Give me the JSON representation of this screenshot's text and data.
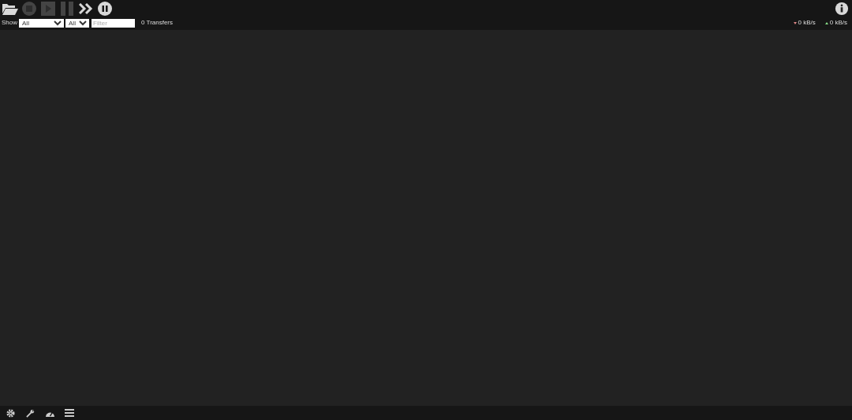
{
  "toolbar": {
    "buttons": [
      {
        "kind": "open",
        "disabled": false
      },
      {
        "kind": "stop",
        "disabled": true
      },
      {
        "kind": "play",
        "disabled": true
      },
      {
        "kind": "pause",
        "disabled": true
      },
      {
        "kind": "start-all",
        "disabled": false
      },
      {
        "kind": "pause-all",
        "disabled": false
      }
    ]
  },
  "filterbar": {
    "show_label": "Show",
    "state_filter": "All",
    "tracker_filter": "All",
    "search": {
      "placeholder": "Filter"
    },
    "count": "0 Transfers",
    "download_speed": "0 kB/s",
    "upload_speed": "0 kB/s"
  },
  "footer": {
    "buttons": [
      {
        "kind": "settings"
      },
      {
        "kind": "preferences"
      },
      {
        "kind": "speed"
      },
      {
        "kind": "list"
      }
    ]
  }
}
